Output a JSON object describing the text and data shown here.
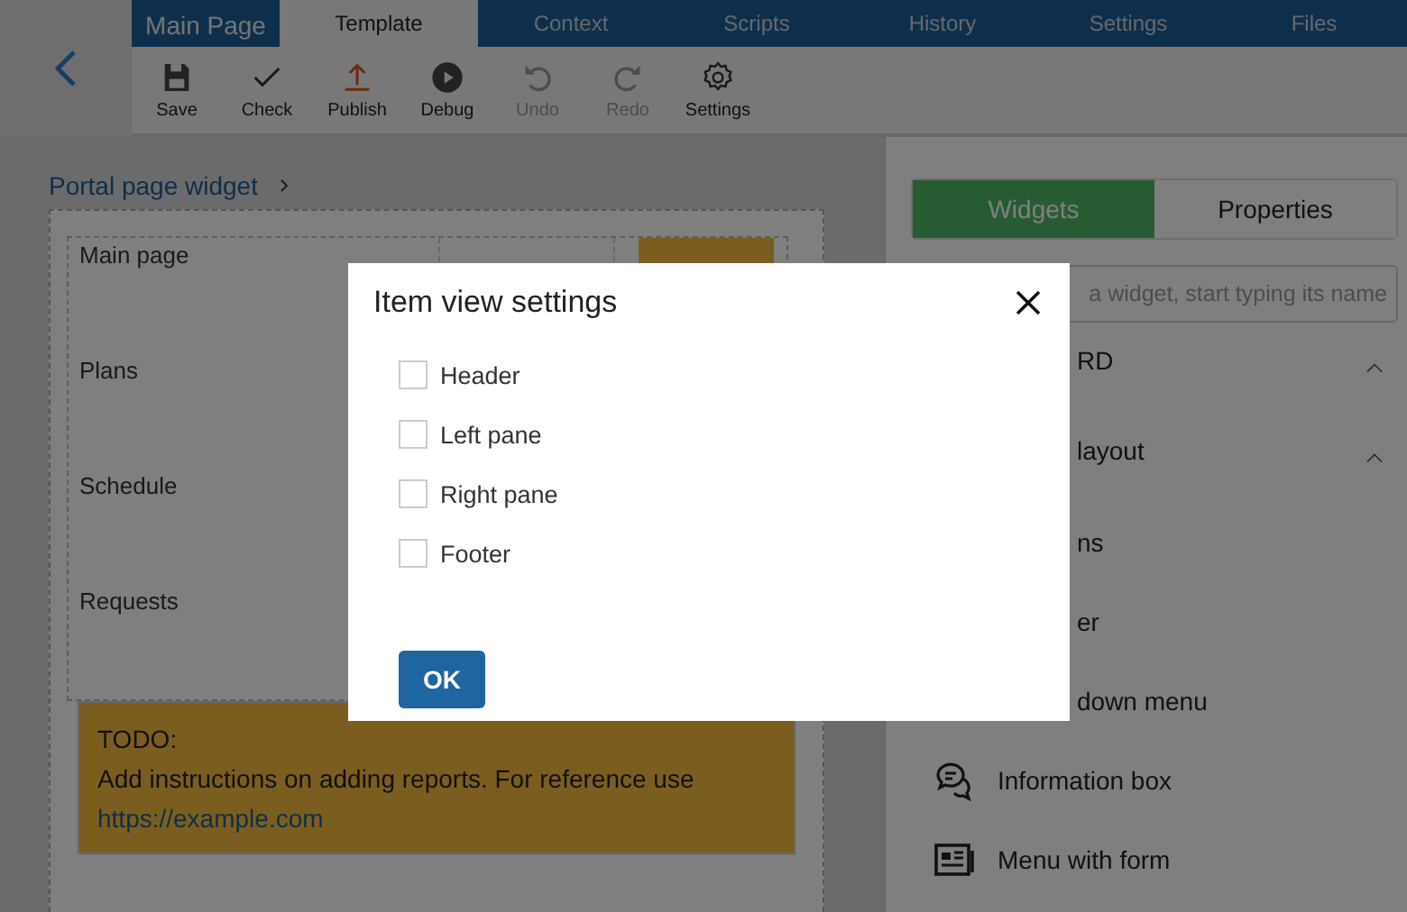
{
  "page_title": "Main Page",
  "tabs": [
    {
      "label": "Template",
      "selected": true
    },
    {
      "label": "Context",
      "selected": false
    },
    {
      "label": "Scripts",
      "selected": false
    },
    {
      "label": "History",
      "selected": false
    },
    {
      "label": "Settings",
      "selected": false
    },
    {
      "label": "Files",
      "selected": false
    }
  ],
  "toolbar": [
    {
      "label": "Save",
      "kind": "save",
      "disabled": false
    },
    {
      "label": "Check",
      "kind": "check",
      "disabled": false
    },
    {
      "label": "Publish",
      "kind": "publish",
      "disabled": false
    },
    {
      "label": "Debug",
      "kind": "debug",
      "disabled": false
    },
    {
      "label": "Undo",
      "kind": "undo",
      "disabled": true
    },
    {
      "label": "Redo",
      "kind": "redo",
      "disabled": true
    },
    {
      "label": "Settings",
      "kind": "settings",
      "disabled": false
    }
  ],
  "breadcrumb": "Portal page widget",
  "layout_rows": [
    "Main page",
    "Plans",
    "Schedule",
    "Requests"
  ],
  "todo_note": {
    "title": "TODO:",
    "text": "Add instructions on adding reports. For reference use",
    "link": "https://example.com"
  },
  "panel": {
    "tabs": [
      {
        "label": "Widgets",
        "selected": true
      },
      {
        "label": "Properties",
        "selected": false
      }
    ],
    "search": {
      "placeholder": "a widget, start typing its name"
    },
    "groups": [
      {
        "label": "RD",
        "expanded": true
      },
      {
        "label": "layout",
        "expanded": true
      }
    ],
    "items": [
      {
        "label": "ns",
        "kind": "covered"
      },
      {
        "label": "er",
        "kind": "covered"
      },
      {
        "label": "down menu",
        "kind": "covered"
      },
      {
        "label": "Information box",
        "kind": "info"
      },
      {
        "label": "Menu with form",
        "kind": "form"
      }
    ]
  },
  "dialog": {
    "title": "Item view settings",
    "options": [
      {
        "label": "Header",
        "checked": false
      },
      {
        "label": "Left pane",
        "checked": false
      },
      {
        "label": "Right pane",
        "checked": false
      },
      {
        "label": "Footer",
        "checked": false
      }
    ],
    "ok": "OK"
  }
}
